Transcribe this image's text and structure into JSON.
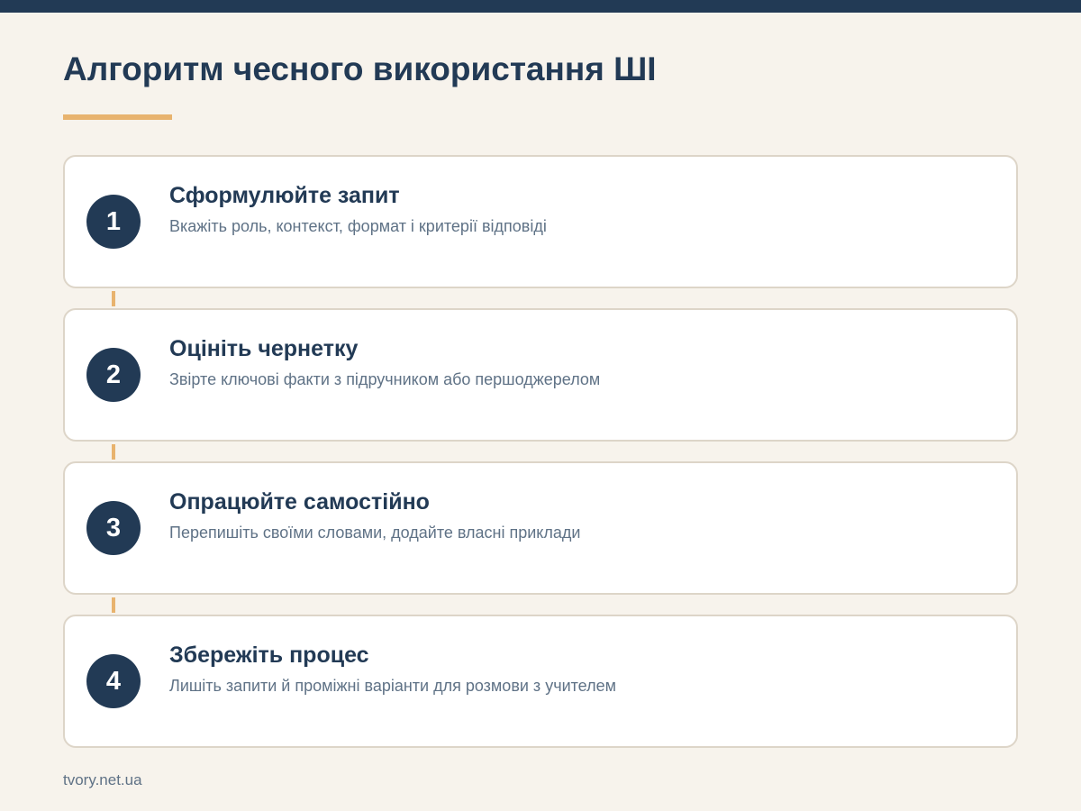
{
  "title": "Алгоритм чесного використання ШІ",
  "steps": [
    {
      "number": "1",
      "title": "Сформулюйте запит",
      "description": "Вкажіть роль, контекст, формат і критерії відповіді"
    },
    {
      "number": "2",
      "title": "Оцініть чернетку",
      "description": "Звірте ключові факти з підручником або першоджерелом"
    },
    {
      "number": "3",
      "title": "Опрацюйте самостійно",
      "description": "Перепишіть своїми словами, додайте власні приклади"
    },
    {
      "number": "4",
      "title": "Збережіть процес",
      "description": "Лишіть запити й проміжні варіанти для розмови з учителем"
    }
  ],
  "footer": {
    "source": "tvory.net.ua"
  },
  "colors": {
    "background": "#f7f3ec",
    "primary": "#223a55",
    "accent": "#e8b36e",
    "card": "#ffffff",
    "card_border": "#ddd5c8",
    "muted_text": "#5f7286"
  }
}
